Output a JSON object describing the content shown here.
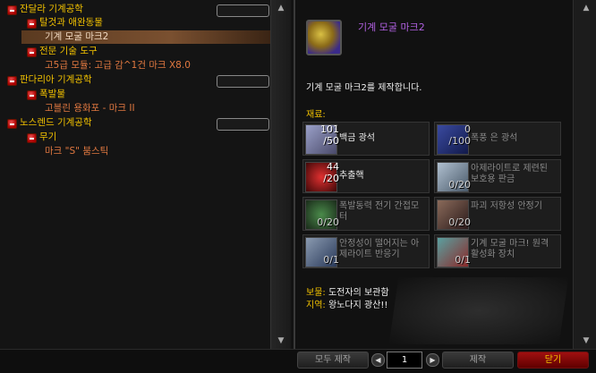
{
  "recipe_list": {
    "rows": [
      {
        "label": "잔달라 기계공학",
        "kind": "category"
      },
      {
        "label": "탈것과 애완동물",
        "kind": "subcategory"
      },
      {
        "label": "기계 모굴 마크2",
        "kind": "recipe",
        "selected": true
      },
      {
        "label": "전문 기술 도구",
        "kind": "subcategory"
      },
      {
        "label": "고5급 모듈: 고급 감^1건 마크 X8.0",
        "kind": "recipe"
      },
      {
        "label": "판다리아 기계공학",
        "kind": "category"
      },
      {
        "label": "폭발물",
        "kind": "subcategory"
      },
      {
        "label": "고블린 용화포 - 마크 II",
        "kind": "recipe"
      },
      {
        "label": "노스렌드 기계공학",
        "kind": "category"
      },
      {
        "label": "무기",
        "kind": "subcategory"
      },
      {
        "label": "마크 \"S\" 붐스틱",
        "kind": "recipe"
      }
    ]
  },
  "detail": {
    "title": "기계 모굴 마크2",
    "description": "기계 모굴 마크2를 제작합니다.",
    "reagents_label": "재료:",
    "reagents": [
      {
        "name": "백금 광석",
        "count": "101\n/50",
        "available": true,
        "icon": "ore-icon",
        "color": "#8a8ab0"
      },
      {
        "name": "폭풍 은 광석",
        "count": "0\n/100",
        "available": false,
        "icon": "ore-icon",
        "color": "#2a3a8a"
      },
      {
        "name": "추출핵",
        "count": "44\n/20",
        "available": true,
        "icon": "vortex-icon",
        "color": "#b01818"
      },
      {
        "name": "아제라이트로 제련된 보호용 판금",
        "count": "0/20",
        "available": false,
        "icon": "plate-icon",
        "color": "#8a9aaa"
      },
      {
        "name": "폭발동력 전기 간접모터",
        "count": "0/20",
        "available": false,
        "icon": "gear-icon",
        "color": "#3a6a3a"
      },
      {
        "name": "파괴 저항성 안정기",
        "count": "0/20",
        "available": false,
        "icon": "stabilizer-icon",
        "color": "#5a3a2a"
      },
      {
        "name": "안정성이 떨어지는 아제라이트 반응기",
        "count": "0/1",
        "available": false,
        "icon": "reactor-icon",
        "color": "#6a7a9a"
      },
      {
        "name": "기계 모굴 마크! 원격 활성화 장치",
        "count": "0/1",
        "available": false,
        "icon": "remote-icon",
        "color": "#8a3a3a"
      }
    ],
    "source": [
      {
        "key": "보물:",
        "value": "도전자의 보관함"
      },
      {
        "key": "지역:",
        "value": "왕노다지 광산!!"
      }
    ]
  },
  "bottom_bar": {
    "create_all_label": "모두 제작",
    "quantity_value": "1",
    "create_label": "제작",
    "close_label": "닫기",
    "decrement_glyph": "◀",
    "increment_glyph": "▶"
  },
  "colors": {
    "category": "#f0c000",
    "recipe": "#e07840",
    "title": "#b060e0"
  }
}
